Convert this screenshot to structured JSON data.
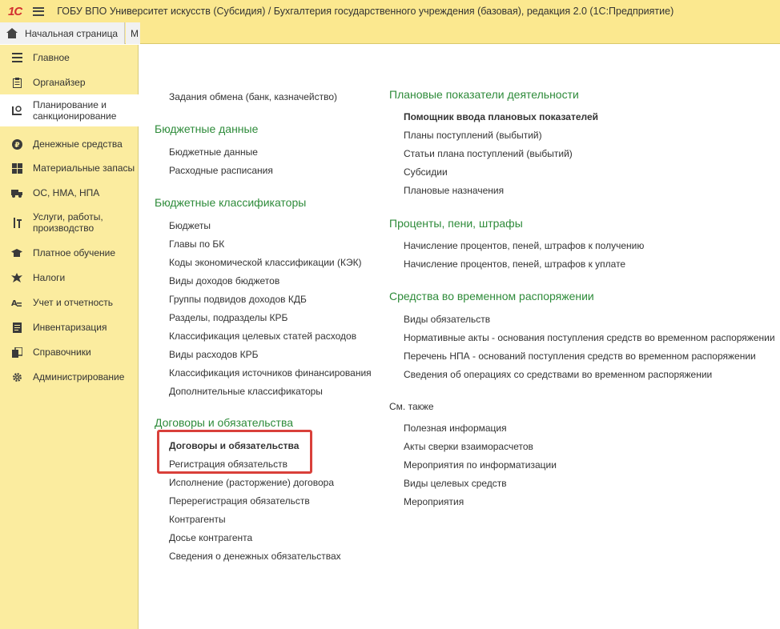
{
  "app": {
    "logo": "1С",
    "title": "ГОБУ ВПО Университет искусств (Субсидия) / Бухгалтерия государственного учреждения (базовая), редакция 2.0  (1С:Предприятие)"
  },
  "tabs": {
    "home_label": "Начальная страница",
    "second_label": "М"
  },
  "sidebar": {
    "items": [
      {
        "label": "Главное",
        "icon": "menu-lines-icon"
      },
      {
        "label": "Органайзер",
        "icon": "clipboard-icon"
      },
      {
        "label": "Планирование и санкционирование",
        "icon": "planning-icon"
      },
      {
        "label": "Денежные средства",
        "icon": "ruble-coin-icon"
      },
      {
        "label": "Материальные запасы",
        "icon": "grid-icon"
      },
      {
        "label": "ОС, НМА, НПА",
        "icon": "truck-icon"
      },
      {
        "label": "Услуги, работы, производство",
        "icon": "tools-icon"
      },
      {
        "label": "Платное обучение",
        "icon": "graduation-cap-icon"
      },
      {
        "label": "Налоги",
        "icon": "eagle-icon"
      },
      {
        "label": "Учет и отчетность",
        "icon": "accounting-icon"
      },
      {
        "label": "Инвентаризация",
        "icon": "document-icon"
      },
      {
        "label": "Справочники",
        "icon": "books-icon"
      },
      {
        "label": "Администрирование",
        "icon": "gear-icon"
      }
    ]
  },
  "left_column": {
    "top_link": "Задания обмена (банк, казначейство)",
    "budget_data": {
      "title": "Бюджетные данные",
      "links": [
        "Бюджетные данные",
        "Расходные расписания"
      ]
    },
    "classifiers": {
      "title": "Бюджетные классификаторы",
      "links": [
        "Бюджеты",
        "Главы по БК",
        "Коды экономической классификации (КЭК)",
        "Виды доходов бюджетов",
        "Группы подвидов доходов КДБ",
        "Разделы, подразделы КРБ",
        "Классификация целевых статей расходов",
        "Виды расходов КРБ",
        "Классификация источников финансирования",
        "Дополнительные классификаторы"
      ]
    },
    "contracts": {
      "title": "Договоры и обязательства",
      "links": [
        "Договоры и обязательства",
        "Регистрация обязательств",
        "Исполнение (расторжение) договора",
        "Перерегистрация обязательств",
        "Контрагенты",
        "Досье контрагента",
        "Сведения о денежных обязательствах"
      ]
    }
  },
  "right_column": {
    "plan_indicators": {
      "title": "Плановые показатели деятельности",
      "links": [
        "Помощник ввода плановых показателей",
        "Планы поступлений (выбытий)",
        "Статьи плана поступлений (выбытий)",
        "Субсидии",
        "Плановые назначения"
      ]
    },
    "penalties": {
      "title": "Проценты, пени, штрафы",
      "links": [
        "Начисление процентов, пеней, штрафов к получению",
        "Начисление процентов, пеней, штрафов к уплате"
      ]
    },
    "temporary_funds": {
      "title": "Средства во временном распоряжении",
      "links": [
        "Виды обязательств",
        "Нормативные акты - основания  поступления средств во временном распоряжении",
        "Перечень НПА - оснований поступления средств во временном распоряжении",
        "Сведения об операциях со средствами во временном распоряжении"
      ]
    },
    "see_also": {
      "title": "См. также",
      "links": [
        "Полезная информация",
        "Акты сверки взаиморасчетов",
        "Мероприятия по информатизации",
        "Виды целевых средств",
        "Мероприятия"
      ]
    }
  },
  "colors": {
    "header_bg": "#fbe88f",
    "sidebar_bg": "#fbec9f",
    "group_title": "#2e8b3a",
    "highlight": "#d9403a",
    "logo": "#d22f2f"
  }
}
